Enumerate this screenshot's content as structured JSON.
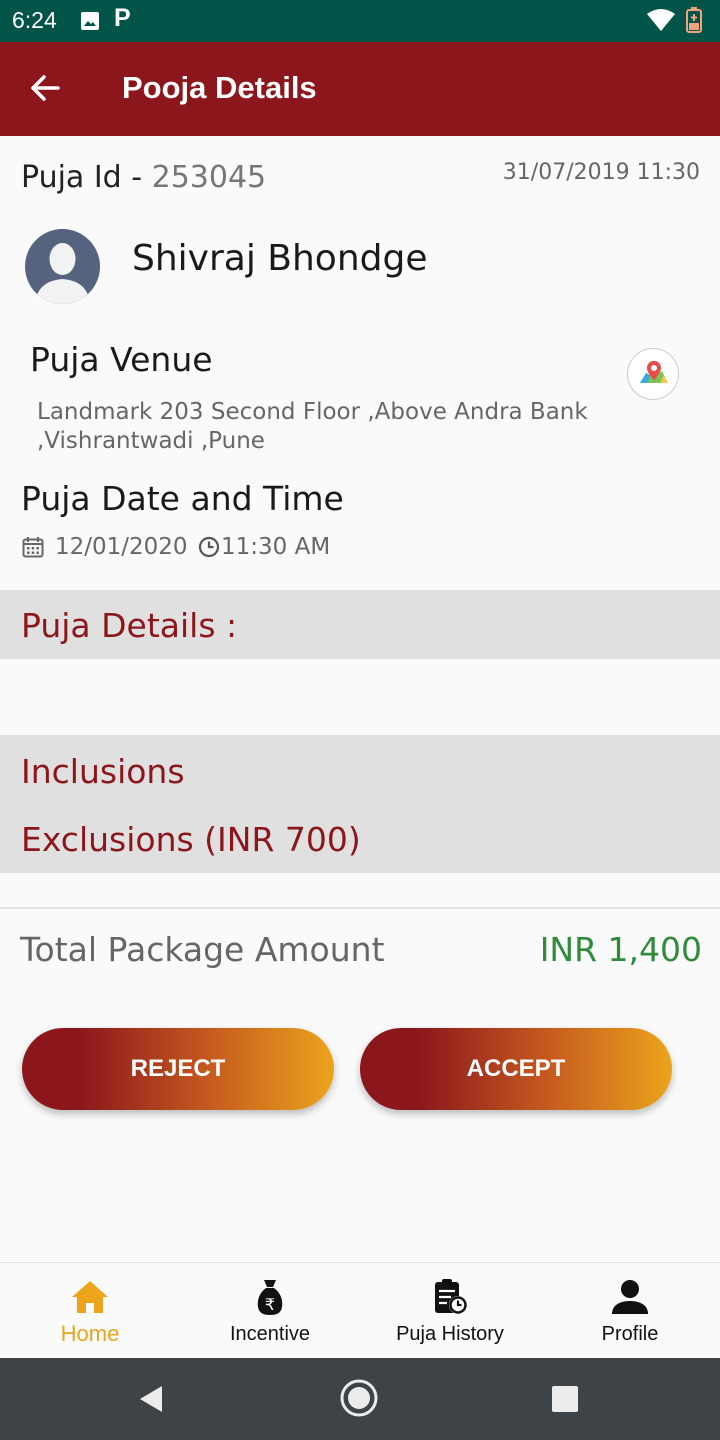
{
  "status_bar": {
    "time": "6:24",
    "carrier_glyph": "P"
  },
  "app_bar": {
    "title": "Pooja Details"
  },
  "puja": {
    "id_label": "Puja Id - ",
    "id_value": "253045",
    "created_at": "31/07/2019 11:30",
    "devotee_name": "Shivraj Bhondge",
    "venue_title": "Puja Venue",
    "venue_address": "Landmark 203 Second Floor ,Above Andra Bank ,Vishrantwadi ,Pune",
    "datetime_title": "Puja Date and Time",
    "date": "12/01/2020",
    "time": "11:30 AM"
  },
  "sections": {
    "details_label": "Puja Details  :",
    "inclusions_label": "Inclusions",
    "exclusions_label": "Exclusions (INR 700)"
  },
  "total": {
    "label": "Total Package Amount",
    "value": "INR 1,400"
  },
  "actions": {
    "reject_label": "REJECT",
    "accept_label": "ACCEPT"
  },
  "bottom_nav": {
    "items": [
      {
        "label": "Home",
        "icon": "home-icon",
        "active": true
      },
      {
        "label": "Incentive",
        "icon": "money-bag-icon",
        "active": false
      },
      {
        "label": "Puja History",
        "icon": "history-icon",
        "active": false
      },
      {
        "label": "Profile",
        "icon": "person-icon",
        "active": false
      }
    ]
  },
  "colors": {
    "primary": "#8b161c",
    "accent": "#eba41c",
    "status_bar": "#005548",
    "amount_green": "#2f8a3a"
  }
}
